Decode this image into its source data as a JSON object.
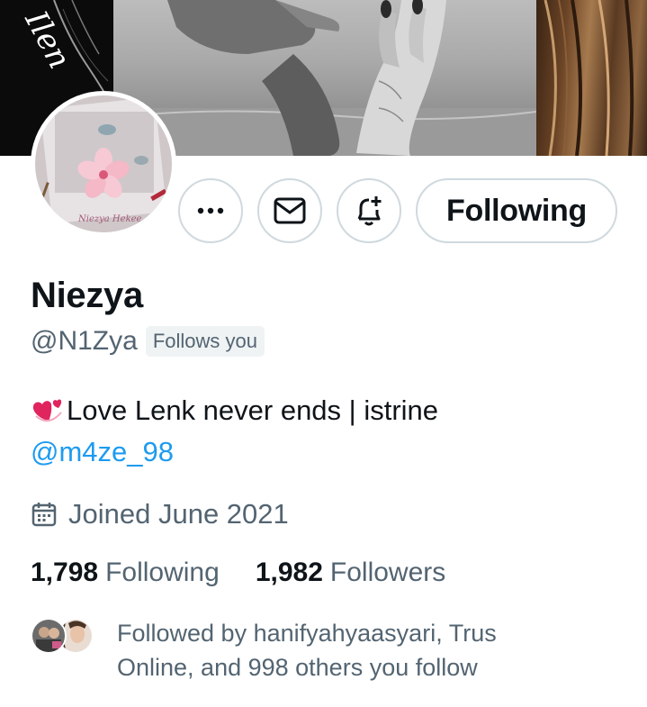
{
  "profile": {
    "display_name": "Niezya",
    "handle": "@N1Zya",
    "follows_you_badge": "Follows you",
    "bio_emoji": "revolving-hearts-icon",
    "bio_text": "Love Lenk never ends | istrine",
    "bio_link": "@m4ze_98",
    "joined_text": "Joined June 2021",
    "banner_script_text": "Ilen",
    "avatar_script_text": "Niezya Hekee"
  },
  "actions": {
    "more_icon": "ellipsis-icon",
    "message_icon": "envelope-icon",
    "notify_icon": "bell-plus-icon",
    "following_label": "Following"
  },
  "stats": {
    "following_count": "1,798",
    "following_label": "Following",
    "followers_count": "1,982",
    "followers_label": "Followers"
  },
  "followed_by": {
    "text": "Followed by hanifyahyaasyari, Trus Online, and 998 others you follow"
  },
  "colors": {
    "text_primary": "#0f1419",
    "text_secondary": "#536471",
    "link": "#1d9bf0",
    "border": "#cfd9de",
    "badge_bg": "#eff3f4"
  }
}
